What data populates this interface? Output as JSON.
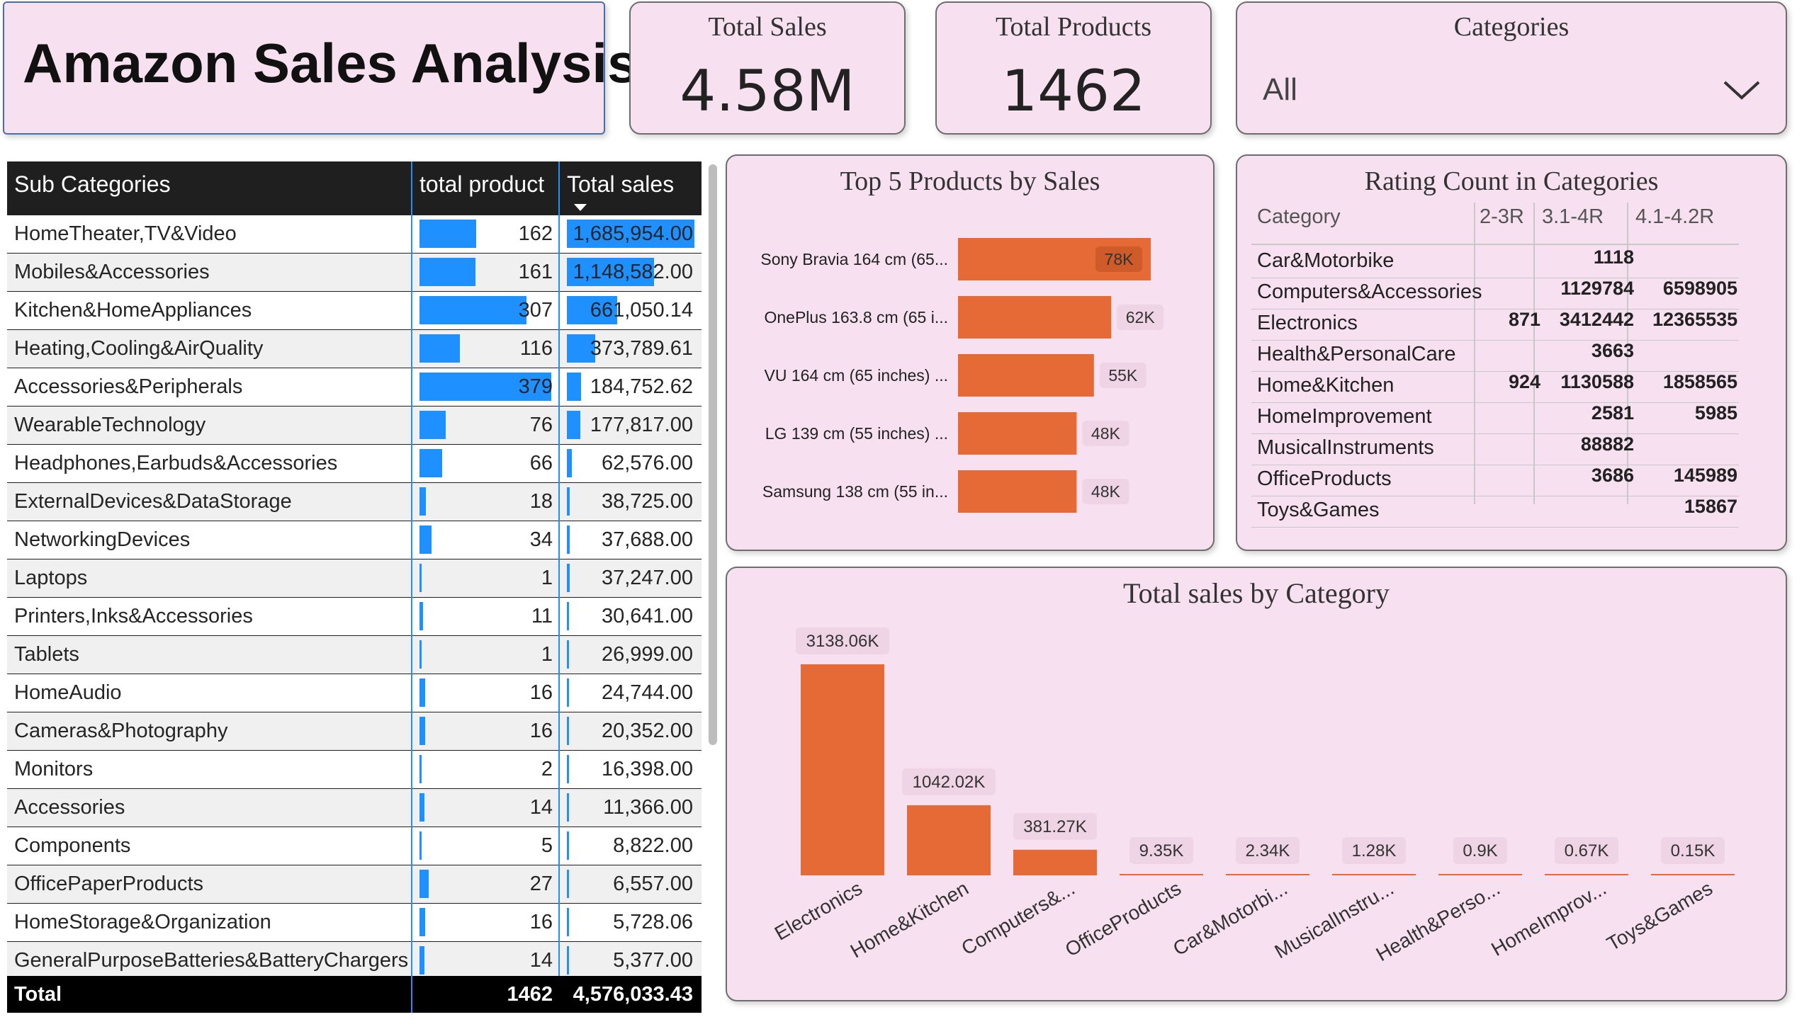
{
  "title": "Amazon Sales Analysis",
  "kpis": {
    "total_sales_label": "Total Sales",
    "total_sales_value": "4.58M",
    "total_products_label": "Total Products",
    "total_products_value": "1462"
  },
  "slicer": {
    "label": "Categories",
    "selected": "All"
  },
  "subcat_table": {
    "headers": [
      "Sub Categories",
      "total product",
      "Total sales"
    ],
    "rows": [
      {
        "name": "HomeTheater,TV&Video",
        "products": "162",
        "sales": "1,685,954.00",
        "p": 162,
        "s": 1685954
      },
      {
        "name": "Mobiles&Accessories",
        "products": "161",
        "sales": "1,148,582.00",
        "p": 161,
        "s": 1148582
      },
      {
        "name": "Kitchen&HomeAppliances",
        "products": "307",
        "sales": "661,050.14",
        "p": 307,
        "s": 661050.14
      },
      {
        "name": "Heating,Cooling&AirQuality",
        "products": "116",
        "sales": "373,789.61",
        "p": 116,
        "s": 373789.61
      },
      {
        "name": "Accessories&Peripherals",
        "products": "379",
        "sales": "184,752.62",
        "p": 379,
        "s": 184752.62
      },
      {
        "name": "WearableTechnology",
        "products": "76",
        "sales": "177,817.00",
        "p": 76,
        "s": 177817
      },
      {
        "name": "Headphones,Earbuds&Accessories",
        "products": "66",
        "sales": "62,576.00",
        "p": 66,
        "s": 62576
      },
      {
        "name": "ExternalDevices&DataStorage",
        "products": "18",
        "sales": "38,725.00",
        "p": 18,
        "s": 38725
      },
      {
        "name": "NetworkingDevices",
        "products": "34",
        "sales": "37,688.00",
        "p": 34,
        "s": 37688
      },
      {
        "name": "Laptops",
        "products": "1",
        "sales": "37,247.00",
        "p": 1,
        "s": 37247
      },
      {
        "name": "Printers,Inks&Accessories",
        "products": "11",
        "sales": "30,641.00",
        "p": 11,
        "s": 30641
      },
      {
        "name": "Tablets",
        "products": "1",
        "sales": "26,999.00",
        "p": 1,
        "s": 26999
      },
      {
        "name": "HomeAudio",
        "products": "16",
        "sales": "24,744.00",
        "p": 16,
        "s": 24744
      },
      {
        "name": "Cameras&Photography",
        "products": "16",
        "sales": "20,352.00",
        "p": 16,
        "s": 20352
      },
      {
        "name": "Monitors",
        "products": "2",
        "sales": "16,398.00",
        "p": 2,
        "s": 16398
      },
      {
        "name": "Accessories",
        "products": "14",
        "sales": "11,366.00",
        "p": 14,
        "s": 11366
      },
      {
        "name": "Components",
        "products": "5",
        "sales": "8,822.00",
        "p": 5,
        "s": 8822
      },
      {
        "name": "OfficePaperProducts",
        "products": "27",
        "sales": "6,557.00",
        "p": 27,
        "s": 6557
      },
      {
        "name": "HomeStorage&Organization",
        "products": "16",
        "sales": "5,728.06",
        "p": 16,
        "s": 5728.06
      },
      {
        "name": "GeneralPurposeBatteries&BatteryChargers",
        "products": "14",
        "sales": "5,377.00",
        "p": 14,
        "s": 5377
      }
    ],
    "total": {
      "label": "Total",
      "products": "1462",
      "sales": "4,576,033.43"
    }
  },
  "rating_table": {
    "title": "Rating Count in Categories",
    "headers": [
      "Category",
      "2-3R",
      "3.1-4R",
      "4.1-4.2R"
    ],
    "rows": [
      {
        "cat": "Car&Motorbike",
        "r1": "",
        "r2": "1118",
        "r3": ""
      },
      {
        "cat": "Computers&Accessories",
        "r1": "",
        "r2": "1129784",
        "r3": "6598905"
      },
      {
        "cat": "Electronics",
        "r1": "871",
        "r2": "3412442",
        "r3": "12365535"
      },
      {
        "cat": "Health&PersonalCare",
        "r1": "",
        "r2": "3663",
        "r3": ""
      },
      {
        "cat": "Home&Kitchen",
        "r1": "924",
        "r2": "1130588",
        "r3": "1858565"
      },
      {
        "cat": "HomeImprovement",
        "r1": "",
        "r2": "2581",
        "r3": "5985"
      },
      {
        "cat": "MusicalInstruments",
        "r1": "",
        "r2": "88882",
        "r3": ""
      },
      {
        "cat": "OfficeProducts",
        "r1": "",
        "r2": "3686",
        "r3": "145989"
      },
      {
        "cat": "Toys&Games",
        "r1": "",
        "r2": "",
        "r3": "15867"
      }
    ]
  },
  "chart_data": [
    {
      "type": "bar",
      "orientation": "horizontal",
      "title": "Top 5 Products by Sales",
      "categories": [
        "Sony Bravia 164 cm (65...",
        "OnePlus 163.8 cm (65 i...",
        "VU 164 cm (65 inches) ...",
        "LG 139 cm (55 inches) ...",
        "Samsung 138 cm (55 in..."
      ],
      "values": [
        78000,
        62000,
        55000,
        48000,
        48000
      ],
      "labels": [
        "78K",
        "62K",
        "55K",
        "48K",
        "48K"
      ],
      "color": "#e66a35"
    },
    {
      "type": "bar",
      "orientation": "vertical",
      "title": "Total sales by Category",
      "categories": [
        "Electronics",
        "Home&Kitchen",
        "Computers&...",
        "OfficeProducts",
        "Car&Motorbi...",
        "MusicalInstru...",
        "Health&Perso...",
        "HomeImprov...",
        "Toys&Games"
      ],
      "values": [
        3138.06,
        1042.02,
        381.27,
        9.35,
        2.34,
        1.28,
        0.9,
        0.67,
        0.15
      ],
      "labels": [
        "3138.06K",
        "1042.02K",
        "381.27K",
        "9.35K",
        "2.34K",
        "1.28K",
        "0.9K",
        "0.67K",
        "0.15K"
      ],
      "unit": "K",
      "color": "#e66a35"
    }
  ]
}
